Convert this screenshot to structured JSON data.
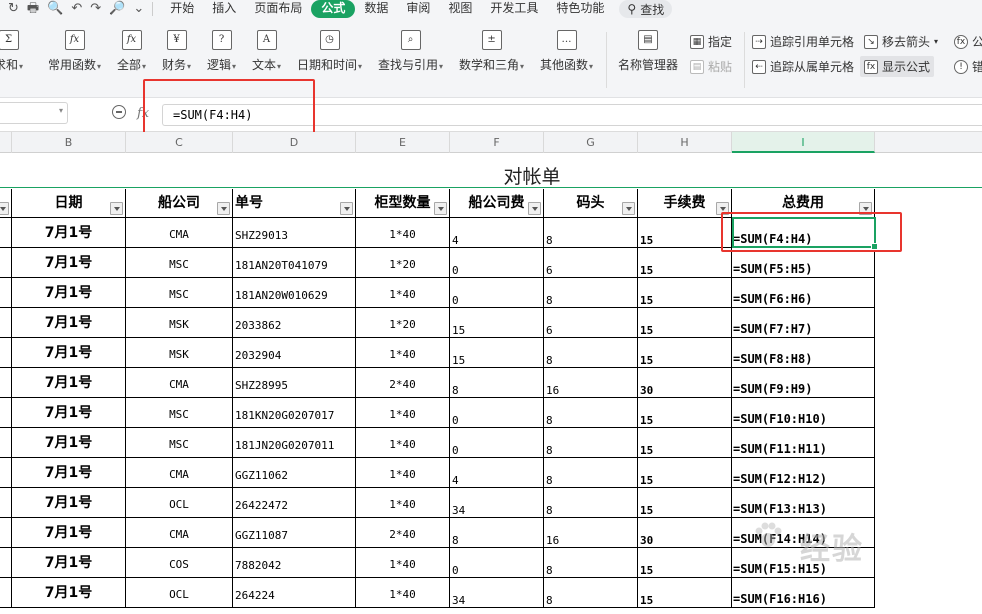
{
  "menubar": {
    "quick_access": [
      "↻",
      "🖶",
      "🔍",
      "↶",
      "↷",
      "🔎",
      "⌄"
    ],
    "tabs": [
      "开始",
      "插入",
      "页面布局",
      "公式",
      "数据",
      "审阅",
      "视图",
      "开发工具",
      "特色功能"
    ],
    "active_tab": "公式",
    "search_label": "查找"
  },
  "ribbon": {
    "buttons": [
      {
        "label": "求和",
        "icon": "sum-icon",
        "glyph": "Σ"
      },
      {
        "label": "常用函数",
        "icon": "fx-icon",
        "glyph": "fx"
      },
      {
        "label": "全部",
        "icon": "fx-all-icon",
        "glyph": "fx"
      },
      {
        "label": "财务",
        "icon": "yen-icon",
        "glyph": "¥"
      },
      {
        "label": "逻辑",
        "icon": "logic-icon",
        "glyph": "?"
      },
      {
        "label": "文本",
        "icon": "text-icon",
        "glyph": "A"
      },
      {
        "label": "日期和时间",
        "icon": "clock-icon",
        "glyph": "◷"
      },
      {
        "label": "查找与引用",
        "icon": "lookup-icon",
        "glyph": "⌕"
      },
      {
        "label": "数学和三角",
        "icon": "math-icon",
        "glyph": "±"
      },
      {
        "label": "其他函数",
        "icon": "more-functions-icon",
        "glyph": "…"
      },
      {
        "label": "名称管理器",
        "icon": "name-manager-icon",
        "glyph": "▤"
      }
    ],
    "small": {
      "define": "指定",
      "paste": "粘贴",
      "trace_precedents": "追踪引用单元格",
      "trace_dependents": "追踪从属单元格",
      "remove_arrows": "移去箭头",
      "show_formulas": "显示公式",
      "clipped_1": "公",
      "clipped_2": "错"
    }
  },
  "formula_bar": {
    "fx_label": "fx",
    "formula": "=SUM(F4:H4)"
  },
  "columns": [
    "B",
    "C",
    "D",
    "E",
    "F",
    "G",
    "H",
    "I"
  ],
  "selected_column": "I",
  "sheet": {
    "title": "对帐单",
    "headers": [
      "日期",
      "船公司",
      "单号",
      "柜型数量",
      "船公司费",
      "码头",
      "手续费",
      "总费用"
    ],
    "rows": [
      {
        "date": "7月1号",
        "company": "CMA",
        "no": "SHZ29013",
        "qty": "1*40",
        "f": "4",
        "g": "8",
        "h": "15",
        "total": "=SUM(F4:H4)"
      },
      {
        "date": "7月1号",
        "company": "MSC",
        "no": "181AN20T041079",
        "qty": "1*20",
        "f": "0",
        "g": "6",
        "h": "15",
        "total": "=SUM(F5:H5)"
      },
      {
        "date": "7月1号",
        "company": "MSC",
        "no": "181AN20W010629",
        "qty": "1*40",
        "f": "0",
        "g": "8",
        "h": "15",
        "total": "=SUM(F6:H6)"
      },
      {
        "date": "7月1号",
        "company": "MSK",
        "no": "2033862",
        "qty": "1*20",
        "f": "15",
        "g": "6",
        "h": "15",
        "total": "=SUM(F7:H7)"
      },
      {
        "date": "7月1号",
        "company": "MSK",
        "no": "2032904",
        "qty": "1*40",
        "f": "15",
        "g": "8",
        "h": "15",
        "total": "=SUM(F8:H8)"
      },
      {
        "date": "7月1号",
        "company": "CMA",
        "no": "SHZ28995",
        "qty": "2*40",
        "f": "8",
        "g": "16",
        "h": "30",
        "total": "=SUM(F9:H9)"
      },
      {
        "date": "7月1号",
        "company": "MSC",
        "no": "181KN20G0207017",
        "qty": "1*40",
        "f": "0",
        "g": "8",
        "h": "15",
        "total": "=SUM(F10:H10)"
      },
      {
        "date": "7月1号",
        "company": "MSC",
        "no": "181JN20G0207011",
        "qty": "1*40",
        "f": "0",
        "g": "8",
        "h": "15",
        "total": "=SUM(F11:H11)"
      },
      {
        "date": "7月1号",
        "company": "CMA",
        "no": "GGZ11062",
        "qty": "1*40",
        "f": "4",
        "g": "8",
        "h": "15",
        "total": "=SUM(F12:H12)"
      },
      {
        "date": "7月1号",
        "company": "OCL",
        "no": "26422472",
        "qty": "1*40",
        "f": "34",
        "g": "8",
        "h": "15",
        "total": "=SUM(F13:H13)"
      },
      {
        "date": "7月1号",
        "company": "CMA",
        "no": "GGZ11087",
        "qty": "2*40",
        "f": "8",
        "g": "16",
        "h": "30",
        "total": "=SUM(F14:H14)"
      },
      {
        "date": "7月1号",
        "company": "COS",
        "no": "7882042",
        "qty": "1*40",
        "f": "0",
        "g": "8",
        "h": "15",
        "total": "=SUM(F15:H15)"
      },
      {
        "date": "7月1号",
        "company": "OCL",
        "no": "264224",
        "qty": "1*40",
        "f": "34",
        "g": "8",
        "h": "15",
        "total": "=SUM(F16:H16)"
      }
    ]
  },
  "watermark": "经验",
  "colors": {
    "accent": "#1aa262",
    "highlight": "#e8352e"
  }
}
